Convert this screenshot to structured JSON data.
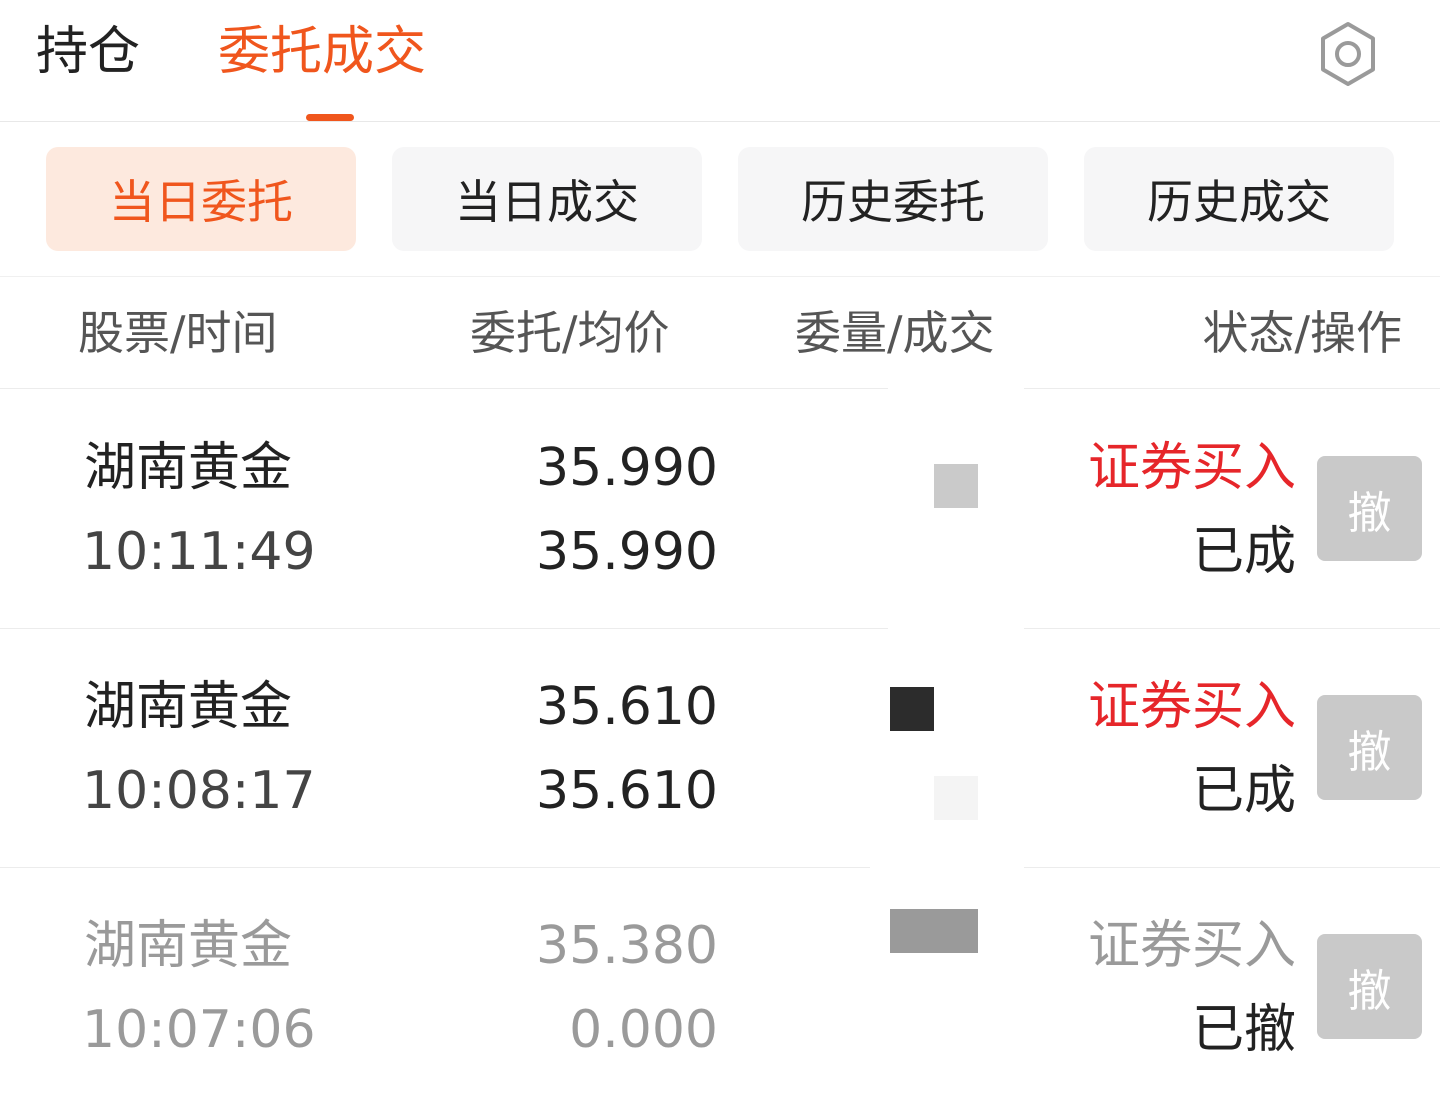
{
  "top_tabs": [
    {
      "label": "持仓"
    },
    {
      "label": "委托成交"
    }
  ],
  "icons": {
    "settings": "gear-icon"
  },
  "filters": [
    {
      "label": "当日委托"
    },
    {
      "label": "当日成交"
    },
    {
      "label": "历史委托"
    },
    {
      "label": "历史成交"
    }
  ],
  "columns": [
    "股票/时间",
    "委托/均价",
    "委量/成交",
    "状态/操作"
  ],
  "rows": [
    {
      "name": "湖南黄金",
      "time": "10:11:49",
      "order_price": "35.990",
      "avg_price": "35.990",
      "status_top": "证券买入",
      "status_bottom": "已成",
      "action": "撤"
    },
    {
      "name": "湖南黄金",
      "time": "10:08:17",
      "order_price": "35.610",
      "avg_price": "35.610",
      "status_top": "证券买入",
      "status_bottom": "已成",
      "action": "撤"
    },
    {
      "name": "湖南黄金",
      "time": "10:07:06",
      "order_price": "35.380",
      "avg_price": "0.000",
      "status_top": "证券买入",
      "status_bottom": "已撤",
      "action": "撤"
    }
  ],
  "colors": {
    "accent": "#f0561d",
    "buy": "#e6262a",
    "disabled": "#c9c9c9"
  }
}
